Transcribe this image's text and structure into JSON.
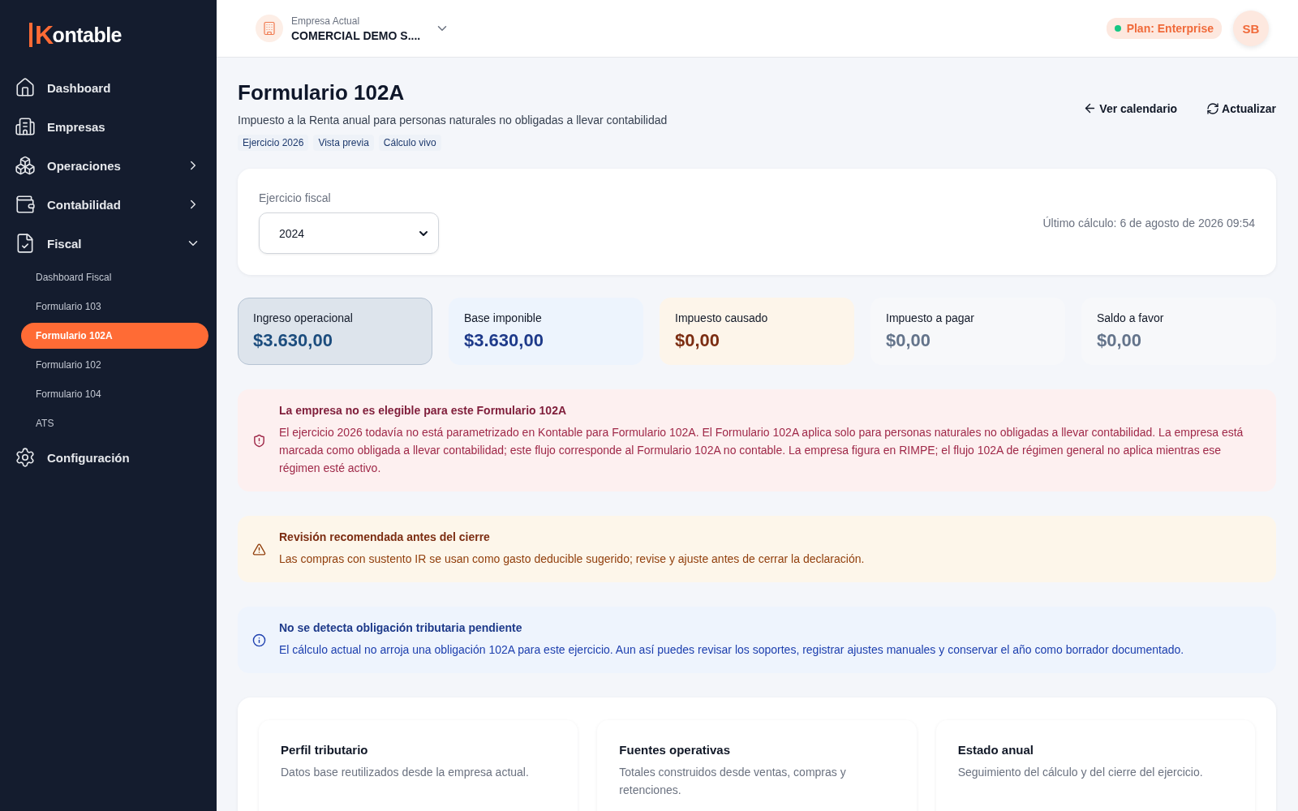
{
  "sidebar": {
    "logo": {
      "mark": "K",
      "text": "ontable"
    },
    "items": [
      {
        "label": "Dashboard",
        "kind": "link"
      },
      {
        "label": "Empresas",
        "kind": "link"
      },
      {
        "label": "Operaciones",
        "kind": "group",
        "expanded": false
      },
      {
        "label": "Contabilidad",
        "kind": "group",
        "expanded": false
      },
      {
        "label": "Fiscal",
        "kind": "group",
        "expanded": true,
        "children": [
          {
            "label": "Dashboard Fiscal",
            "selected": false
          },
          {
            "label": "Formulario 103",
            "selected": false
          },
          {
            "label": "Formulario 102A",
            "selected": true
          },
          {
            "label": "Formulario 102",
            "selected": false
          },
          {
            "label": "Formulario 104",
            "selected": false
          },
          {
            "label": "ATS",
            "selected": false
          }
        ]
      },
      {
        "label": "Configuración",
        "kind": "link"
      }
    ]
  },
  "header": {
    "company_label": "Empresa Actual",
    "company_name": "COMERCIAL DEMO S....",
    "plan": "Plan: Enterprise",
    "avatar": "SB"
  },
  "page": {
    "title": "Formulario 102A",
    "subtitle": "Impuesto a la Renta anual para personas naturales no obligadas a llevar contabilidad",
    "tags": [
      "Ejercicio 2026",
      "Vista previa",
      "Cálculo vivo"
    ],
    "actions": [
      "Ver calendario",
      "Actualizar"
    ]
  },
  "filter": {
    "label": "Ejercicio fiscal",
    "value": "2024",
    "last_calc": "Último cálculo: 6 de agosto de 2026 09:54"
  },
  "stats": [
    {
      "label": "Ingreso operacional",
      "value": "$3.630,00",
      "kind": "neutral",
      "selected": true
    },
    {
      "label": "Base imponible",
      "value": "$3.630,00",
      "kind": "info",
      "selected": false
    },
    {
      "label": "Impuesto causado",
      "value": "$0,00",
      "kind": "warning",
      "selected": false
    },
    {
      "label": "Impuesto a pagar",
      "value": "$0,00",
      "kind": "muted",
      "selected": false
    },
    {
      "label": "Saldo a favor",
      "value": "$0,00",
      "kind": "muted",
      "selected": false
    }
  ],
  "alerts": [
    {
      "kind": "error",
      "title": "La empresa no es elegible para este Formulario 102A",
      "text": "El ejercicio 2026 todavía no está parametrizado en Kontable para Formulario 102A. El Formulario 102A aplica solo para personas naturales no obligadas a llevar contabilidad. La empresa está marcada como obligada a llevar contabilidad; este flujo corresponde al Formulario 102A no contable. La empresa figura en RIMPE; el flujo 102A de régimen general no aplica mientras ese régimen esté activo."
    },
    {
      "kind": "warning",
      "title": "Revisión recomendada antes del cierre",
      "text": "Las compras con sustento IR se usan como gasto deducible sugerido; revise y ajuste antes de cerrar la declaración."
    },
    {
      "kind": "info",
      "title": "No se detecta obligación tributaria pendiente",
      "text": "El cálculo actual no arroja una obligación 102A para este ejercicio. Aun así puedes revisar los soportes, registrar ajustes manuales y conservar el año como borrador documentado."
    }
  ],
  "panels": [
    {
      "title": "Perfil tributario",
      "description": "Datos base reutilizados desde la empresa actual."
    },
    {
      "title": "Fuentes operativas",
      "description": "Totales construidos desde ventas, compras y retenciones."
    },
    {
      "title": "Estado anual",
      "description": "Seguimiento del cálculo y del cierre del ejercicio."
    }
  ]
}
